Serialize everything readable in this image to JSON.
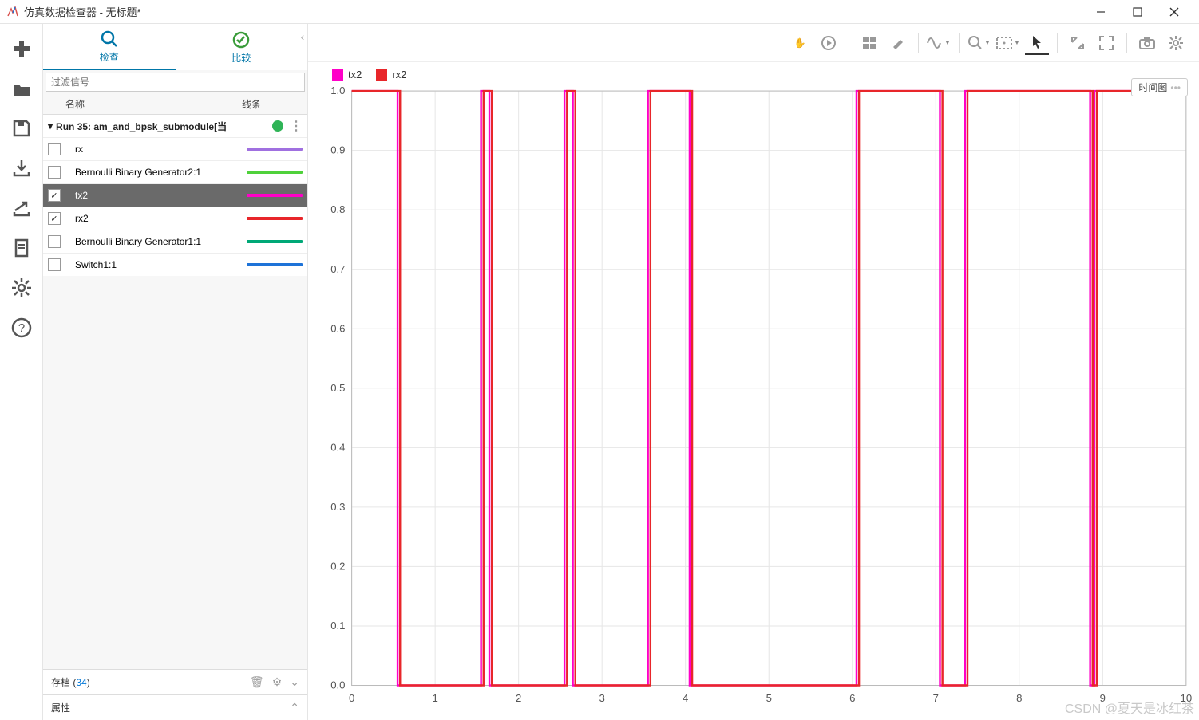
{
  "window": {
    "title": "仿真数据检查器 - 无标题*"
  },
  "tabs": {
    "inspect": "检查",
    "compare": "比较"
  },
  "filter": {
    "placeholder": "过滤信号"
  },
  "columns": {
    "name": "名称",
    "line": "线条"
  },
  "run": {
    "label": "Run 35: am_and_bpsk_submodule[当",
    "status_color": "#2fb457"
  },
  "signals": [
    {
      "name": "rx",
      "checked": false,
      "selected": false,
      "color": "#a070e0"
    },
    {
      "name": "Bernoulli Binary Generator2:1",
      "checked": false,
      "selected": false,
      "color": "#4fd13b"
    },
    {
      "name": "tx2",
      "checked": true,
      "selected": true,
      "color": "#ff00c8"
    },
    {
      "name": "rx2",
      "checked": true,
      "selected": false,
      "color": "#e8262a"
    },
    {
      "name": "Bernoulli Binary Generator1:1",
      "checked": false,
      "selected": false,
      "color": "#00a877"
    },
    {
      "name": "Switch1:1",
      "checked": false,
      "selected": false,
      "color": "#1e73d8"
    }
  ],
  "archive": {
    "label_prefix": "存档 (",
    "count": "34",
    "label_suffix": ")"
  },
  "properties": {
    "label": "属性"
  },
  "plot": {
    "legend": [
      {
        "name": "tx2",
        "color": "#ff00c8"
      },
      {
        "name": "rx2",
        "color": "#e8262a"
      }
    ],
    "badge": "时间图"
  },
  "watermark": "CSDN @夏天是冰红茶",
  "chart_data": {
    "type": "line",
    "title": "",
    "xlabel": "",
    "ylabel": "",
    "xlim": [
      0,
      10
    ],
    "ylim": [
      0,
      1
    ],
    "xticks": [
      0,
      1,
      2,
      3,
      4,
      5,
      6,
      7,
      8,
      9,
      10
    ],
    "yticks": [
      0,
      0.1,
      0.2,
      0.3,
      0.4,
      0.5,
      0.6,
      0.7,
      0.8,
      0.9,
      1.0
    ],
    "series": [
      {
        "name": "tx2",
        "color": "#ff00c8",
        "transitions": [
          [
            0,
            1
          ],
          [
            0.55,
            0
          ],
          [
            1.55,
            1
          ],
          [
            1.65,
            0
          ],
          [
            2.55,
            1
          ],
          [
            2.65,
            0
          ],
          [
            3.55,
            1
          ],
          [
            4.05,
            0
          ],
          [
            6.05,
            1
          ],
          [
            7.05,
            0
          ],
          [
            7.35,
            1
          ],
          [
            8.85,
            0
          ],
          [
            8.9,
            1
          ],
          [
            10,
            1
          ]
        ]
      },
      {
        "name": "rx2",
        "color": "#e8262a",
        "transitions": [
          [
            0,
            1
          ],
          [
            0.58,
            0
          ],
          [
            1.58,
            1
          ],
          [
            1.68,
            0
          ],
          [
            2.58,
            1
          ],
          [
            2.68,
            0
          ],
          [
            3.58,
            1
          ],
          [
            4.08,
            0
          ],
          [
            6.08,
            1
          ],
          [
            7.08,
            0
          ],
          [
            7.38,
            1
          ],
          [
            8.88,
            0
          ],
          [
            8.93,
            1
          ],
          [
            10,
            1
          ]
        ]
      }
    ]
  }
}
